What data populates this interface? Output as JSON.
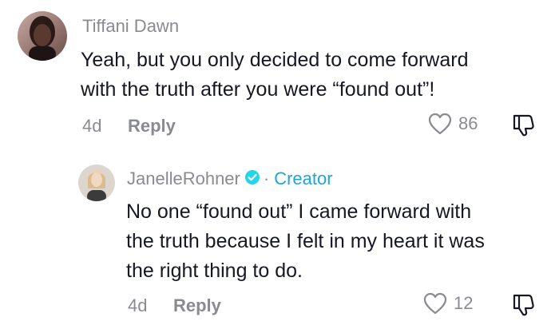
{
  "comment": {
    "username": "Tiffani Dawn",
    "text_line1": "Yeah, but you only decided to come forward",
    "text_line2": "with the truth after you were “found out”!",
    "time": "4d",
    "reply_label": "Reply",
    "like_count": "86"
  },
  "reply": {
    "username": "JanelleRohner",
    "separator": "·",
    "badge_label": "Creator",
    "text_line1": "No one “found out” I came forward with",
    "text_line2": "the truth because I felt in my heart it was",
    "text_line3": "the right thing to do.",
    "time": "4d",
    "reply_label": "Reply",
    "like_count": "12"
  },
  "colors": {
    "text": "#161823",
    "muted": "#8a8b91",
    "creator": "#20a5d8",
    "verified": "#20d5ec"
  },
  "icons": [
    "heart-icon",
    "dislike-icon",
    "verified-icon"
  ]
}
